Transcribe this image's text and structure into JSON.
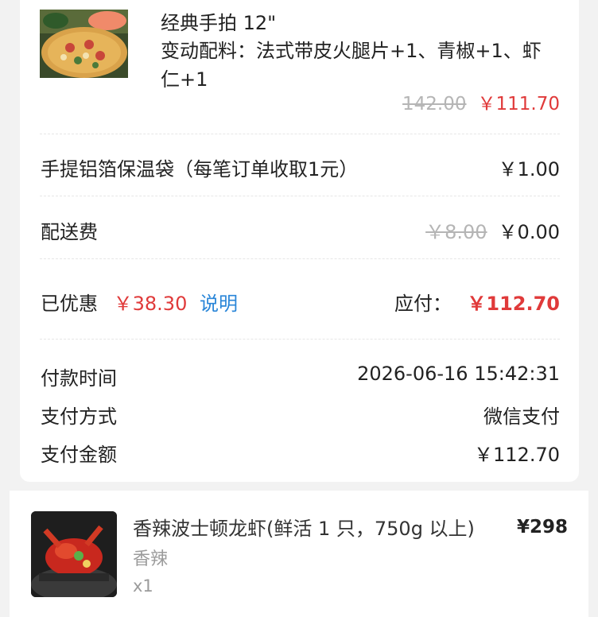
{
  "order_card": {
    "product": {
      "image_icon": "pizza-image",
      "title": "经典手拍 12\"",
      "options": "变动配料：法式带皮火腿片+1、青椒+1、虾仁+1",
      "original_price": "142.00",
      "price": "￥111.70"
    },
    "bag_fee": {
      "label": "手提铝箔保温袋（每笔订单收取1元）",
      "value": "￥1.00"
    },
    "delivery_fee": {
      "label": "配送费",
      "original": "￥8.00",
      "value": "￥0.00"
    },
    "discount": {
      "label": "已优惠",
      "amount": "￥38.30",
      "explain_link": "说明",
      "payable_label": "应付：",
      "payable_amount": "￥112.70"
    },
    "payment": {
      "time_label": "付款时间",
      "time_value": "2026-06-16 15:42:31",
      "method_label": "支付方式",
      "method_value": "微信支付",
      "amount_label": "支付金额",
      "amount_value": "￥112.70"
    }
  },
  "next_item": {
    "image_icon": "lobster-image",
    "title": "香辣波士顿龙虾(鲜活 1 只，750g 以上)",
    "flavor": "香辣",
    "qty": "x1",
    "price": "¥298"
  },
  "colors": {
    "accent_red": "#e03a3a",
    "link_blue": "#2a86d8",
    "muted": "#b5b5b5"
  }
}
